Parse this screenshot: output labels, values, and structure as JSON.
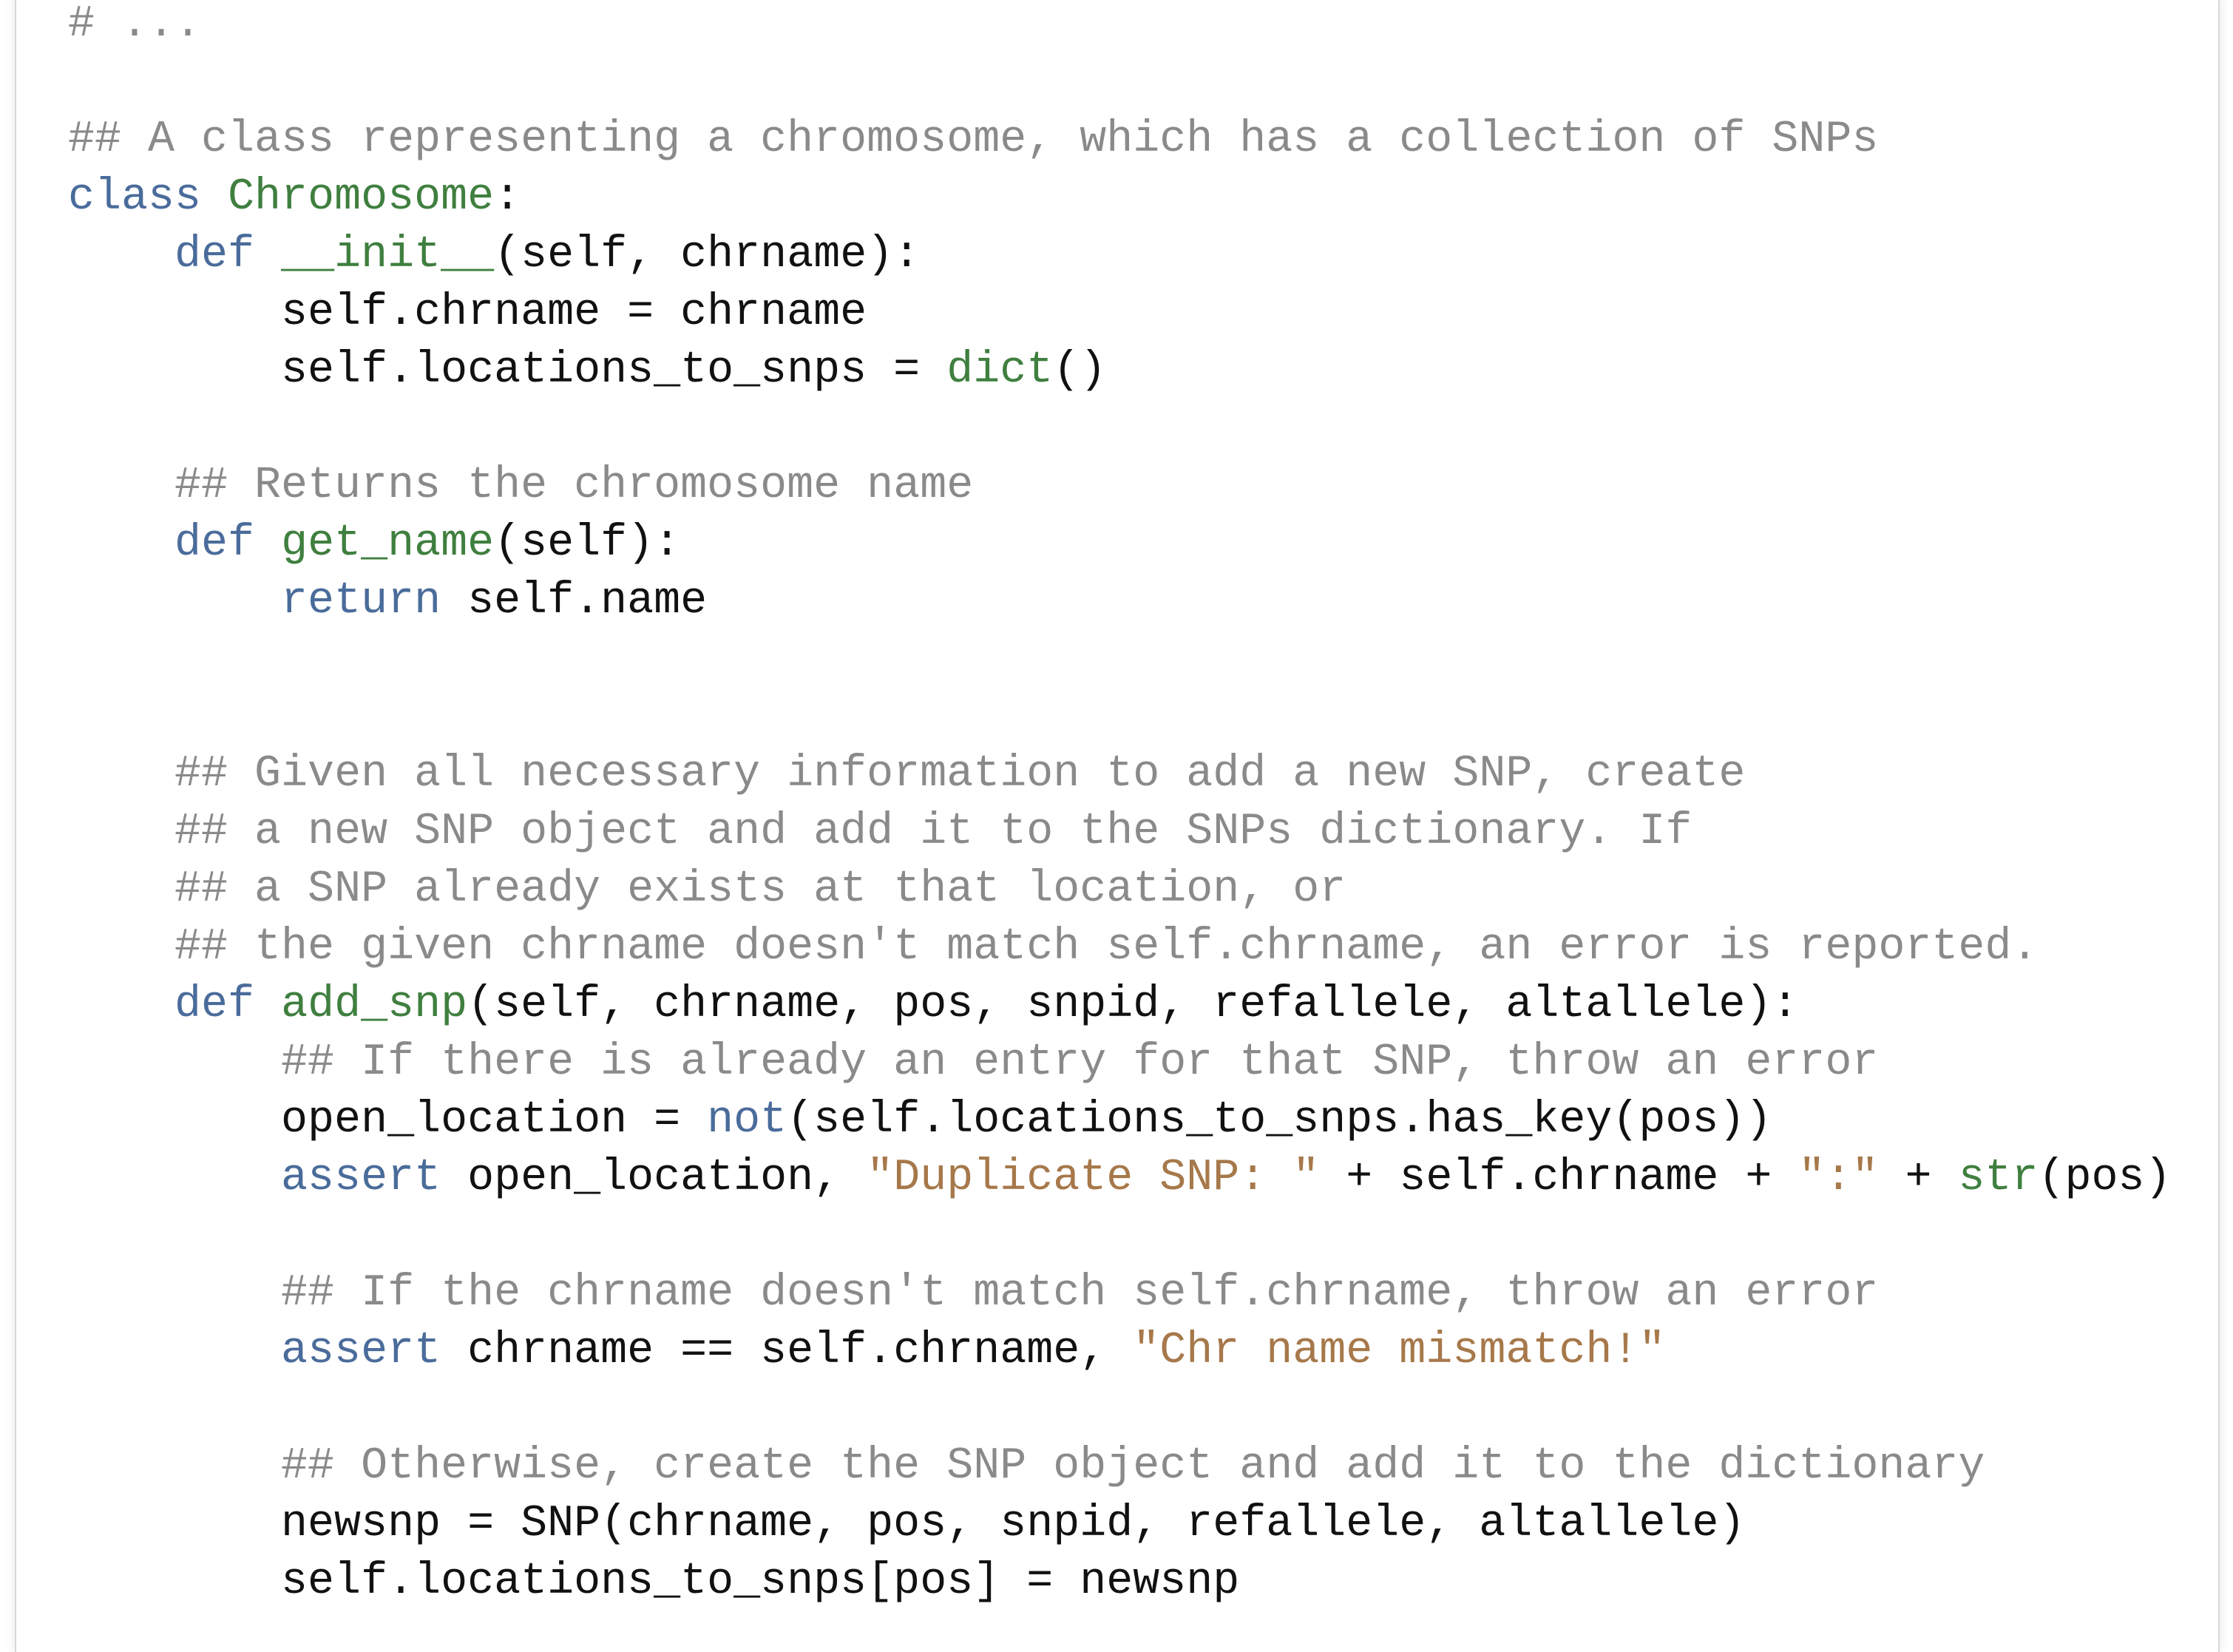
{
  "colors": {
    "comment": "#8a8a8a",
    "keyword": "#4a6c9b",
    "function": "#3f7f3f",
    "string": "#a6784a",
    "text": "#111111",
    "background": "#ffffff"
  },
  "lines": [
    [
      [
        "cmt",
        "# ..."
      ]
    ],
    [],
    [
      [
        "cmt",
        "## A class representing a chromosome, which has a collection of SNPs"
      ]
    ],
    [
      [
        "kw",
        "class"
      ],
      [
        "plain",
        " "
      ],
      [
        "fn",
        "Chromosome"
      ],
      [
        "plain",
        ":"
      ]
    ],
    [
      [
        "plain",
        "    "
      ],
      [
        "kw",
        "def"
      ],
      [
        "plain",
        " "
      ],
      [
        "fn",
        "__init__"
      ],
      [
        "plain",
        "(self, chrname):"
      ]
    ],
    [
      [
        "plain",
        "        self.chrname = chrname"
      ]
    ],
    [
      [
        "plain",
        "        self.locations_to_snps = "
      ],
      [
        "fn",
        "dict"
      ],
      [
        "plain",
        "()"
      ]
    ],
    [],
    [
      [
        "plain",
        "    "
      ],
      [
        "cmt",
        "## Returns the chromosome name"
      ]
    ],
    [
      [
        "plain",
        "    "
      ],
      [
        "kw",
        "def"
      ],
      [
        "plain",
        " "
      ],
      [
        "fn",
        "get_name"
      ],
      [
        "plain",
        "(self):"
      ]
    ],
    [
      [
        "plain",
        "        "
      ],
      [
        "kw",
        "return"
      ],
      [
        "plain",
        " self.name"
      ]
    ],
    [],
    [],
    [
      [
        "plain",
        "    "
      ],
      [
        "cmt",
        "## Given all necessary information to add a new SNP, create"
      ]
    ],
    [
      [
        "plain",
        "    "
      ],
      [
        "cmt",
        "## a new SNP object and add it to the SNPs dictionary. If"
      ]
    ],
    [
      [
        "plain",
        "    "
      ],
      [
        "cmt",
        "## a SNP already exists at that location, or"
      ]
    ],
    [
      [
        "plain",
        "    "
      ],
      [
        "cmt",
        "## the given chrname doesn't match self.chrname, an error is reported."
      ]
    ],
    [
      [
        "plain",
        "    "
      ],
      [
        "kw",
        "def"
      ],
      [
        "plain",
        " "
      ],
      [
        "fn",
        "add_snp"
      ],
      [
        "plain",
        "(self, chrname, pos, snpid, refallele, altallele):"
      ]
    ],
    [
      [
        "plain",
        "        "
      ],
      [
        "cmt",
        "## If there is already an entry for that SNP, throw an error"
      ]
    ],
    [
      [
        "plain",
        "        open_location = "
      ],
      [
        "kw",
        "not"
      ],
      [
        "plain",
        "(self.locations_to_snps.has_key(pos))"
      ]
    ],
    [
      [
        "plain",
        "        "
      ],
      [
        "kw",
        "assert"
      ],
      [
        "plain",
        " open_location, "
      ],
      [
        "str",
        "\"Duplicate SNP: \""
      ],
      [
        "plain",
        " + self.chrname + "
      ],
      [
        "str",
        "\":\""
      ],
      [
        "plain",
        " + "
      ],
      [
        "fn",
        "str"
      ],
      [
        "plain",
        "(pos)"
      ]
    ],
    [],
    [
      [
        "plain",
        "        "
      ],
      [
        "cmt",
        "## If the chrname doesn't match self.chrname, throw an error"
      ]
    ],
    [
      [
        "plain",
        "        "
      ],
      [
        "kw",
        "assert"
      ],
      [
        "plain",
        " chrname == self.chrname, "
      ],
      [
        "str",
        "\"Chr name mismatch!\""
      ]
    ],
    [],
    [
      [
        "plain",
        "        "
      ],
      [
        "cmt",
        "## Otherwise, create the SNP object and add it to the dictionary"
      ]
    ],
    [
      [
        "plain",
        "        newsnp = SNP(chrname, pos, snpid, refallele, altallele)"
      ]
    ],
    [
      [
        "plain",
        "        self.locations_to_snps[pos] = newsnp"
      ]
    ]
  ]
}
